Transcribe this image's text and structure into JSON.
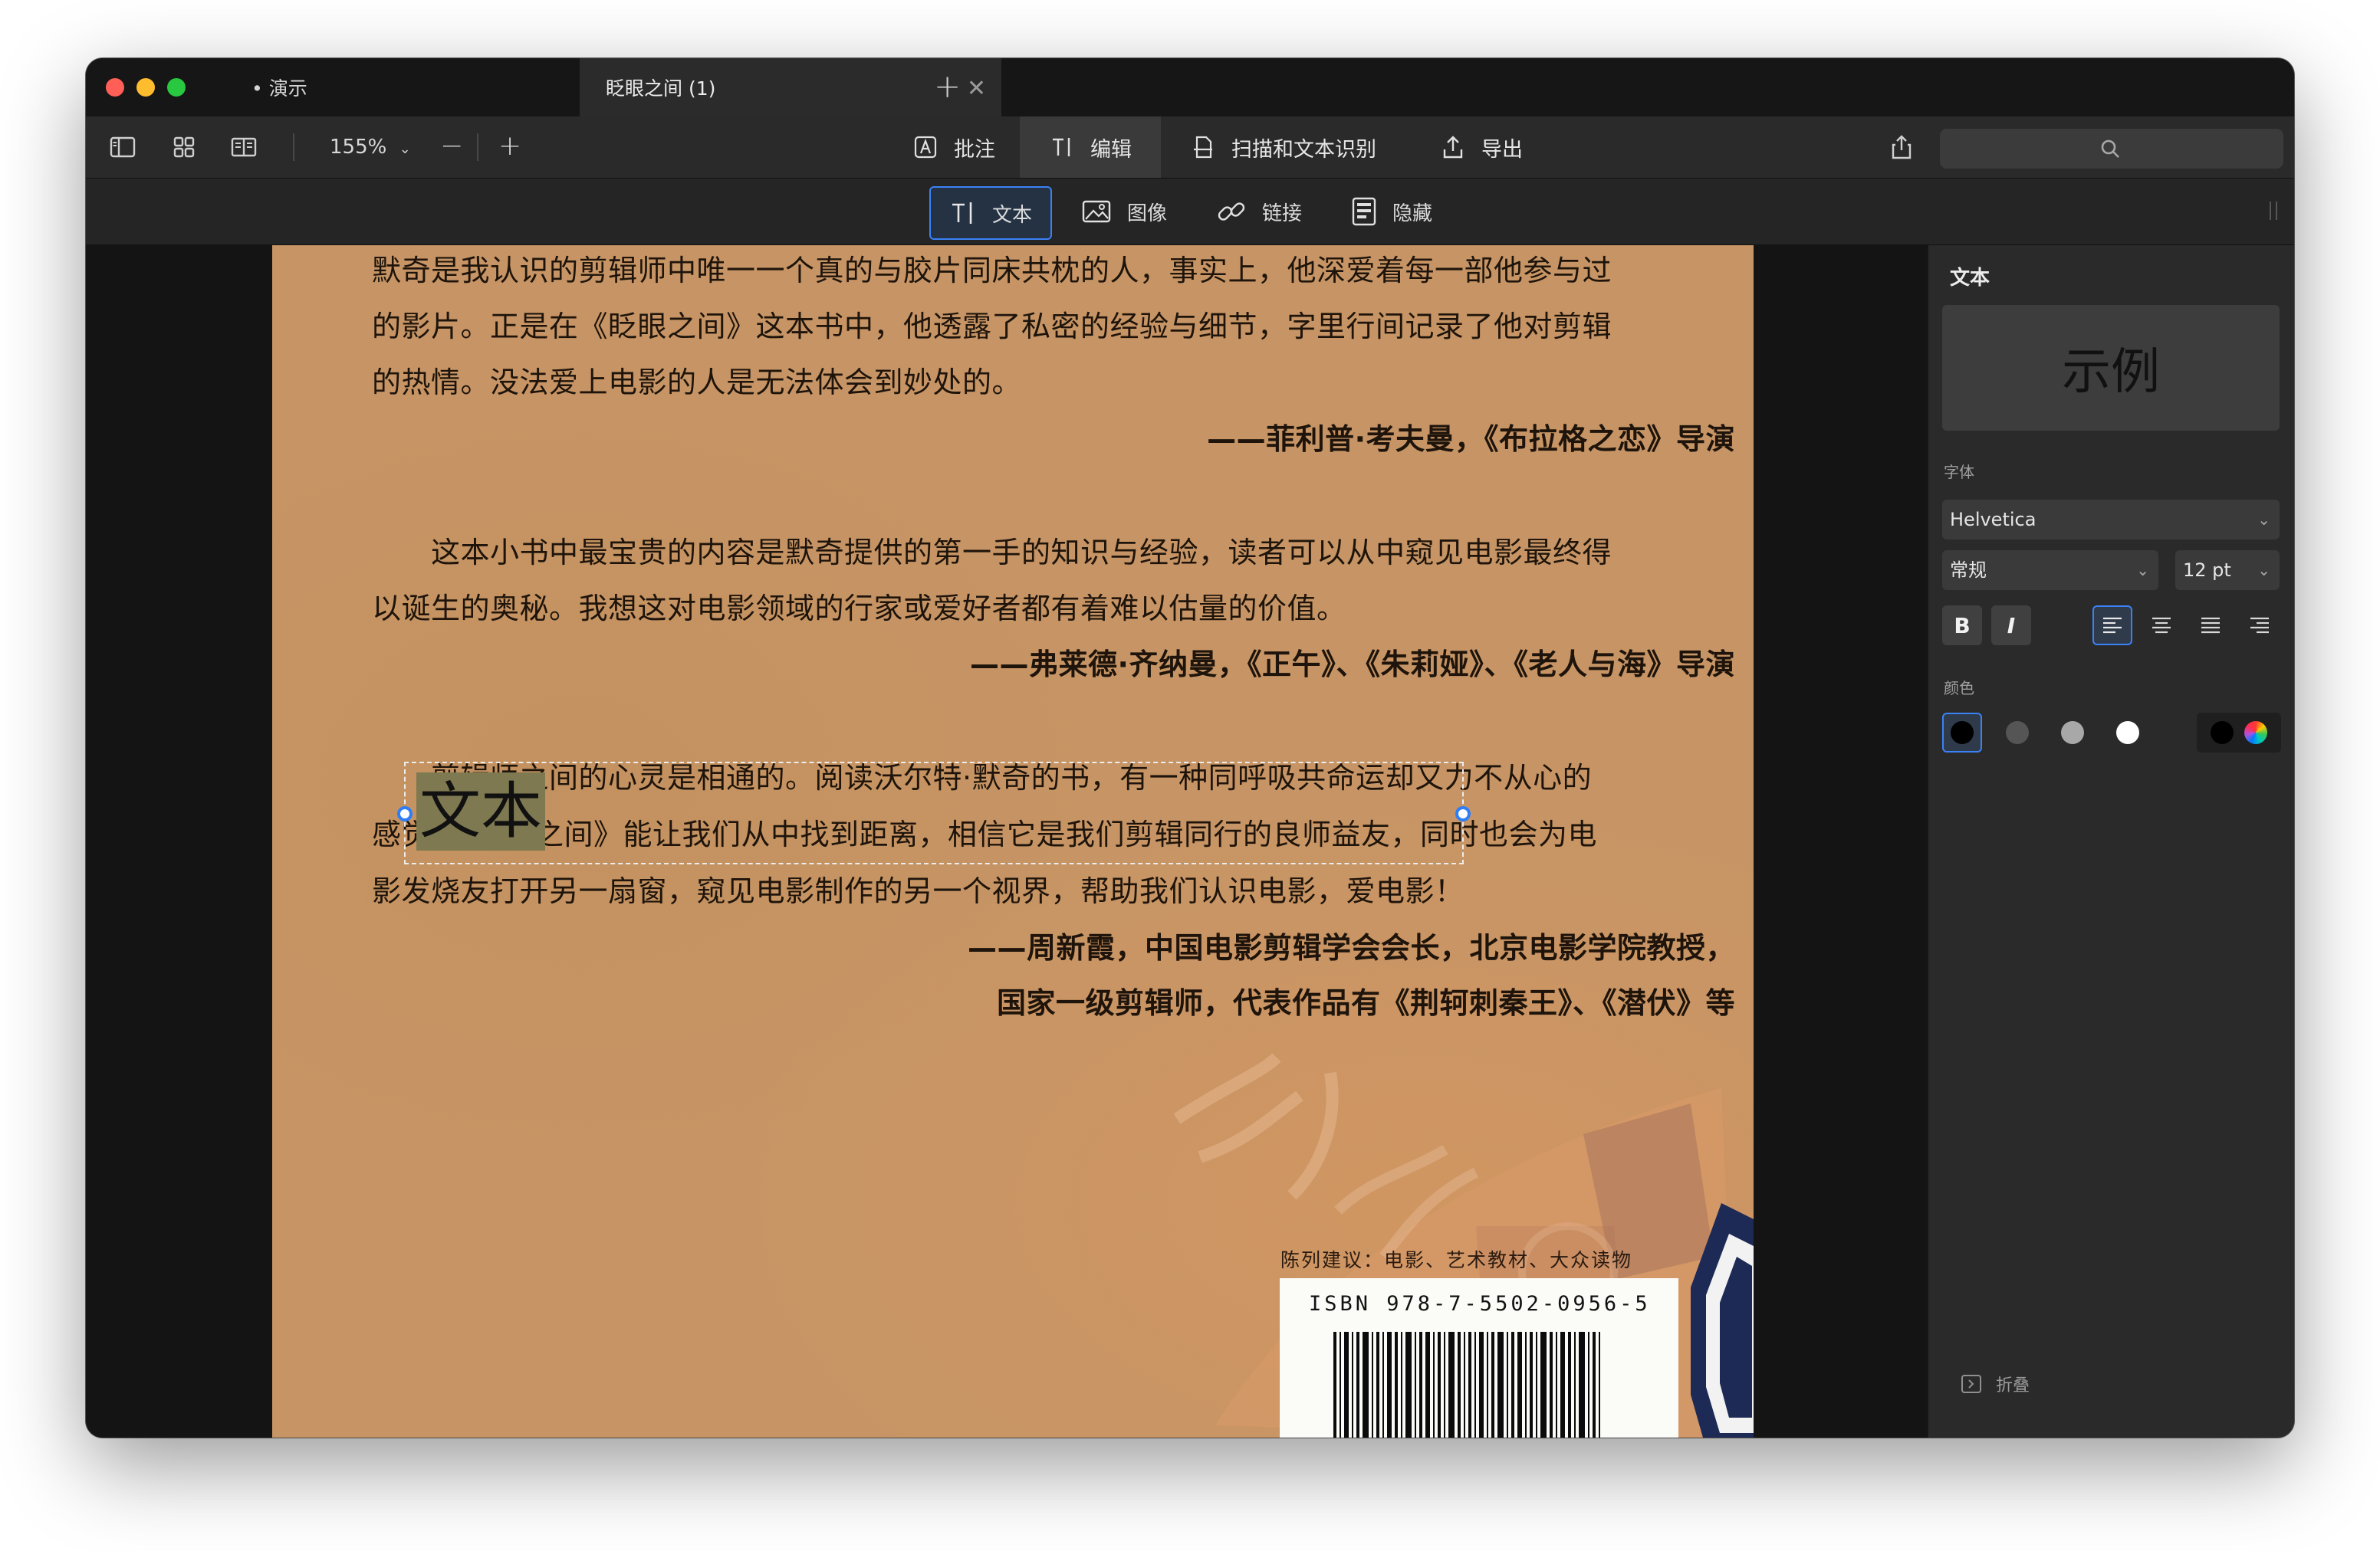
{
  "tabs": [
    {
      "label": "• 演示",
      "active": false
    },
    {
      "label": "眨眼之间 (1)",
      "active": true
    }
  ],
  "toolbar": {
    "zoom_label": "155%",
    "zoom_out": "−",
    "zoom_in": "+",
    "modes": [
      {
        "label": "批注",
        "icon": "annotate-icon"
      },
      {
        "label": "编辑",
        "icon": "text-cursor-icon",
        "active": true
      },
      {
        "label": "扫描和文本识别",
        "icon": "scan-icon"
      },
      {
        "label": "导出",
        "icon": "export-icon"
      }
    ]
  },
  "edit_tools": [
    {
      "label": "文本",
      "icon": "text-tool-icon",
      "active": true
    },
    {
      "label": "图像",
      "icon": "image-icon"
    },
    {
      "label": "链接",
      "icon": "link-icon"
    },
    {
      "label": "隐藏",
      "icon": "redact-icon"
    }
  ],
  "document": {
    "lines": [
      "默奇是我认识的剪辑师中唯一一个真的与胶片同床共枕的人，事实上，他深爱着每一部他参与过",
      "的影片。正是在《眨眼之间》这本书中，他透露了私密的经验与细节，字里行间记录了他对剪辑",
      "的热情。没法爱上电影的人是无法体会到妙处的。",
      "——菲利普·考夫曼，《布拉格之恋》导演",
      "　　这本小书中最宝贵的内容是默奇提供的第一手的知识与经验，读者可以从中窥见电影最终得",
      "以诞生的奥秘。我想这对电影领域的行家或爱好者都有着难以估量的价值。",
      "——弗莱德·齐纳曼，《正午》、《朱莉娅》、《老人与海》导演",
      "　　剪辑师之间的心灵是相通的。阅读沃尔特·默奇的书，有一种同呼吸共命运却又力不从心的",
      "感觉。《眨眼之间》能让我们从中找到距离，相信它是我们剪辑同行的良师益友，同时也会为电",
      "影发烧友打开另一扇窗，窥见电影制作的另一个视界，帮助我们认识电影，爱电影！",
      "——周新霞，中国电影剪辑学会会长，北京电影学院教授，",
      "国家一级剪辑师，代表作品有《荆轲刺秦王》、《潜伏》等"
    ],
    "inserted_text": "文本",
    "category_label": "陈列建议：电影、艺术教材、大众读物",
    "isbn": "ISBN 978-7-5502-0956-5"
  },
  "inspector": {
    "title": "文本",
    "preview_text": "示例",
    "font_label": "字体",
    "font_family": "Helvetica",
    "font_style": "常规",
    "font_size": "12 pt",
    "bold_label": "B",
    "italic_label": "I",
    "alignment": "left",
    "color_label": "颜色",
    "colors": [
      "#000000",
      "#555555",
      "#a8a8a8",
      "#ffffff"
    ],
    "selected_color": "#000000",
    "collapse_label": "折叠"
  }
}
